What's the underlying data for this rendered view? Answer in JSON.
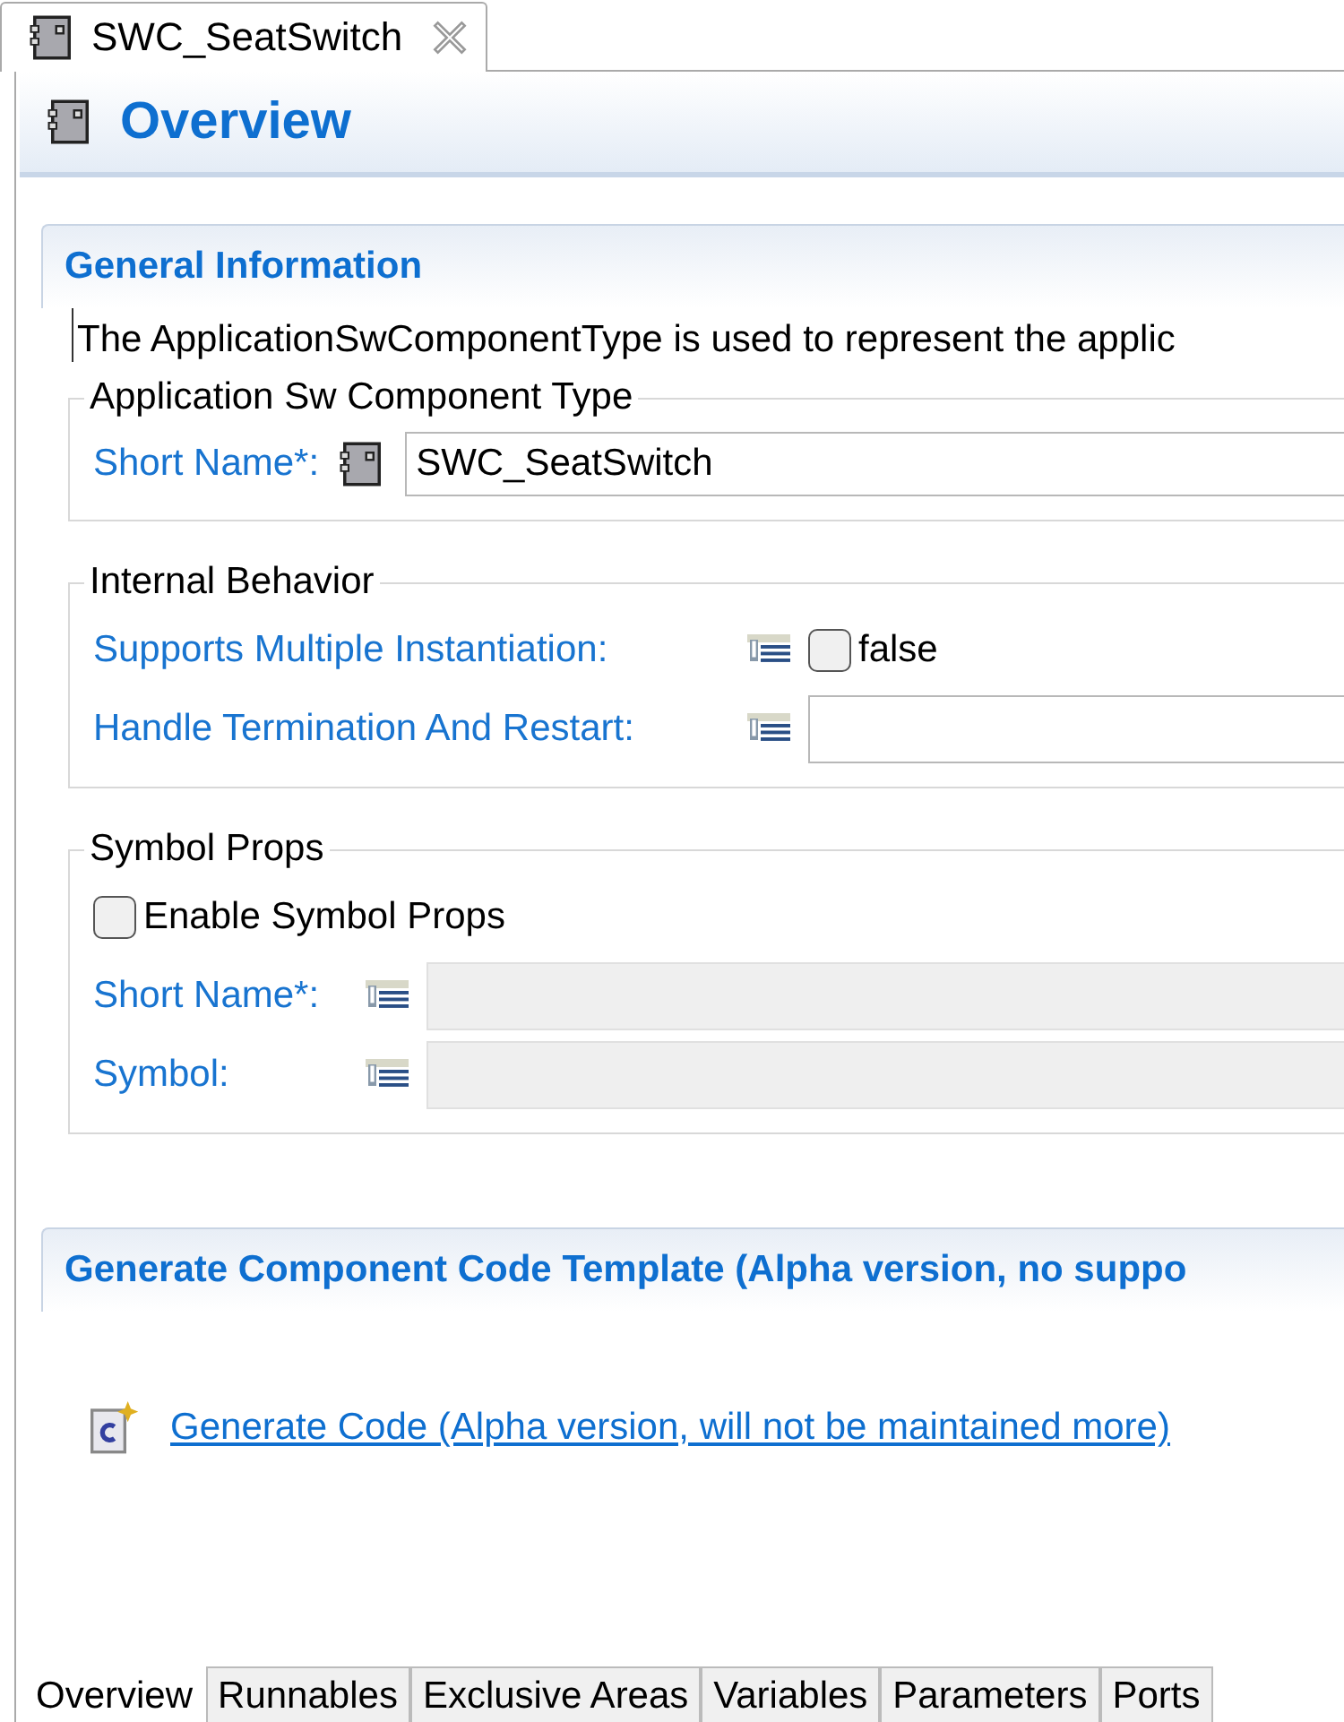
{
  "editor_tab": {
    "title": "SWC_SeatSwitch"
  },
  "header": {
    "title": "Overview"
  },
  "general_information": {
    "title": "General Information",
    "description": "The ApplicationSwComponentType is used to represent the applic",
    "component_type": {
      "legend": "Application Sw Component Type",
      "short_name_label": "Short Name*:",
      "short_name_value": "SWC_SeatSwitch"
    },
    "internal_behavior": {
      "legend": "Internal Behavior",
      "supports_multiple_instantiation": {
        "label": "Supports Multiple Instantiation:",
        "checked": false,
        "value_text": "false"
      },
      "handle_termination": {
        "label": "Handle Termination And Restart:",
        "disabled": false
      }
    },
    "symbol_props": {
      "legend": "Symbol Props",
      "enable": {
        "label": "Enable Symbol Props",
        "checked": false
      },
      "fields": [
        {
          "label": "Short Name*:",
          "disabled": true
        },
        {
          "label": "Symbol:",
          "disabled": true
        }
      ]
    }
  },
  "code_template": {
    "title": "Generate Component Code Template (Alpha version, no suppo",
    "link": "Generate Code (Alpha version, will not be maintained more)"
  },
  "bottom_tabs": [
    {
      "label": "Overview",
      "selected": true
    },
    {
      "label": "Runnables",
      "selected": false
    },
    {
      "label": "Exclusive Areas",
      "selected": false
    },
    {
      "label": "Variables",
      "selected": false
    },
    {
      "label": "Parameters",
      "selected": false
    },
    {
      "label": "Ports",
      "selected": false
    }
  ]
}
